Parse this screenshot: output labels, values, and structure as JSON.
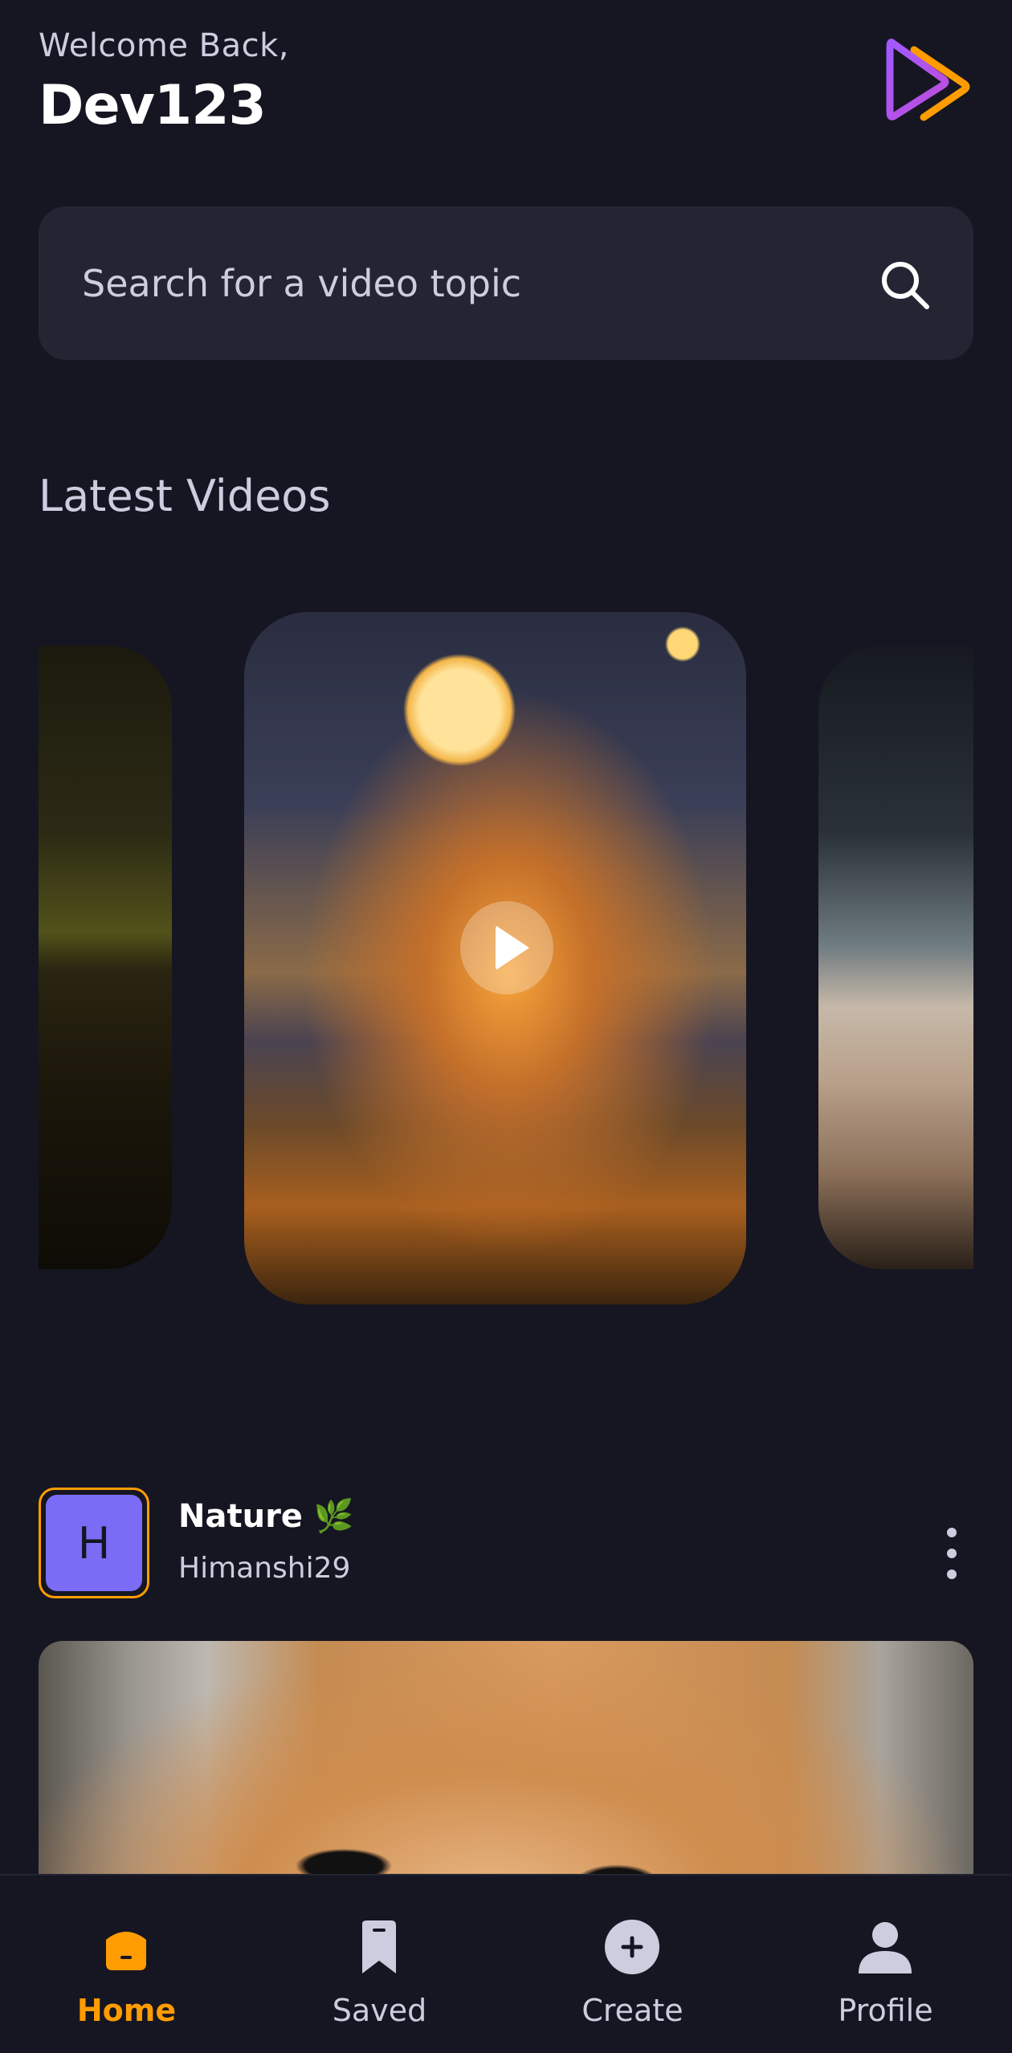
{
  "header": {
    "greeting": "Welcome Back,",
    "username": "Dev123",
    "logo_icon": "app-logo-icon"
  },
  "search": {
    "placeholder": "Search for a video topic",
    "icon": "search-icon"
  },
  "latest": {
    "title": "Latest Videos"
  },
  "post": {
    "avatar_letter": "H",
    "title": "Nature 🌿",
    "author": "Himanshi29",
    "menu_icon": "more-vertical-icon"
  },
  "tabs": [
    {
      "label": "Home",
      "icon": "home-icon",
      "active": true
    },
    {
      "label": "Saved",
      "icon": "bookmark-icon",
      "active": false
    },
    {
      "label": "Create",
      "icon": "plus-circle-icon",
      "active": false
    },
    {
      "label": "Profile",
      "icon": "user-icon",
      "active": false
    }
  ],
  "colors": {
    "background": "#161622",
    "surface": "#232533",
    "accent": "#FF9C01",
    "muted_text": "#CDCDE0",
    "avatar_bg": "#7B6CF6"
  }
}
